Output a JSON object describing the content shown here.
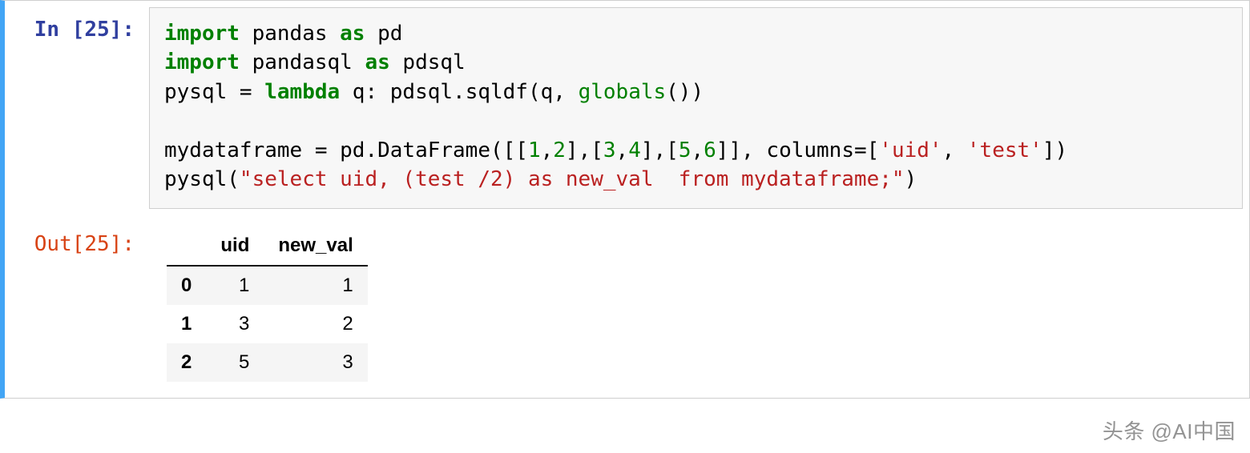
{
  "prompt_in": "In [25]:",
  "prompt_out": "Out[25]:",
  "code": [
    [
      {
        "t": "import",
        "c": "tok-kw"
      },
      {
        "t": " pandas "
      },
      {
        "t": "as",
        "c": "tok-kw"
      },
      {
        "t": " pd"
      }
    ],
    [
      {
        "t": "import",
        "c": "tok-kw"
      },
      {
        "t": " pandasql "
      },
      {
        "t": "as",
        "c": "tok-kw"
      },
      {
        "t": " pdsql"
      }
    ],
    [
      {
        "t": "pysql "
      },
      {
        "t": "="
      },
      {
        "t": " "
      },
      {
        "t": "lambda",
        "c": "tok-kw"
      },
      {
        "t": " q: pdsql.sqldf(q, "
      },
      {
        "t": "globals",
        "c": "tok-builtin"
      },
      {
        "t": "())"
      }
    ],
    [
      {
        "t": ""
      }
    ],
    [
      {
        "t": "mydataframe "
      },
      {
        "t": "="
      },
      {
        "t": " pd.DataFrame([["
      },
      {
        "t": "1",
        "c": "tok-num"
      },
      {
        "t": ","
      },
      {
        "t": "2",
        "c": "tok-num"
      },
      {
        "t": "],["
      },
      {
        "t": "3",
        "c": "tok-num"
      },
      {
        "t": ","
      },
      {
        "t": "4",
        "c": "tok-num"
      },
      {
        "t": "],["
      },
      {
        "t": "5",
        "c": "tok-num"
      },
      {
        "t": ","
      },
      {
        "t": "6",
        "c": "tok-num"
      },
      {
        "t": "]], columns"
      },
      {
        "t": "="
      },
      {
        "t": "["
      },
      {
        "t": "'uid'",
        "c": "tok-str"
      },
      {
        "t": ", "
      },
      {
        "t": "'test'",
        "c": "tok-str"
      },
      {
        "t": "])"
      }
    ],
    [
      {
        "t": "pysql("
      },
      {
        "t": "\"select uid, (test /2) as new_val  from mydataframe;\"",
        "c": "tok-str"
      },
      {
        "t": ")"
      }
    ]
  ],
  "dataframe": {
    "columns": [
      "uid",
      "new_val"
    ],
    "index": [
      "0",
      "1",
      "2"
    ],
    "rows": [
      [
        "1",
        "1"
      ],
      [
        "3",
        "2"
      ],
      [
        "5",
        "3"
      ]
    ]
  },
  "watermark": "头条 @AI中国"
}
